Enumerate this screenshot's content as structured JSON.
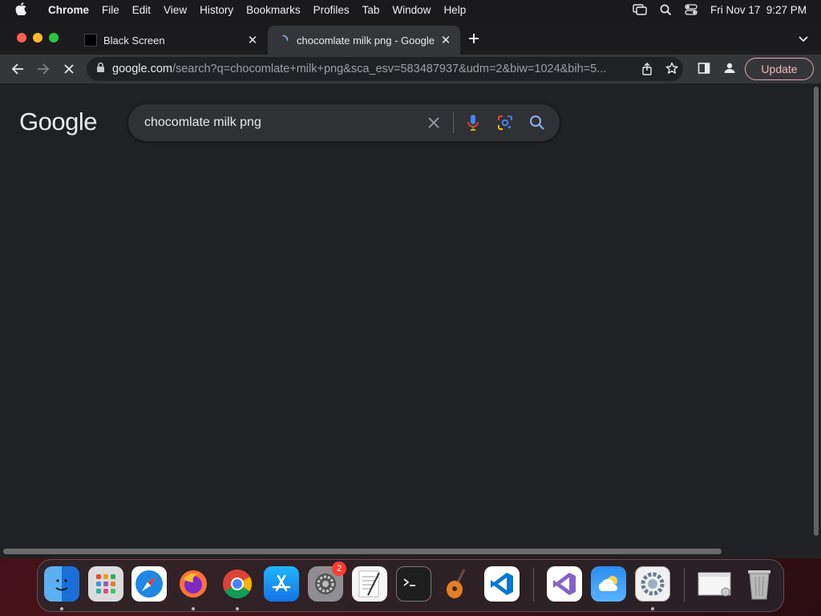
{
  "menubar": {
    "app_name": "Chrome",
    "items": [
      "File",
      "Edit",
      "View",
      "History",
      "Bookmarks",
      "Profiles",
      "Tab",
      "Window",
      "Help"
    ],
    "datetime": "Fri Nov 17  9:27 PM"
  },
  "tabs": [
    {
      "title": "Black Screen",
      "active": false
    },
    {
      "title": "chocomlate milk png - Google",
      "active": true
    }
  ],
  "toolbar": {
    "url_host": "google.com",
    "url_rest": "/search?q=chocomlate+milk+png&sca_esv=583487937&udm=2&biw=1024&bih=5...",
    "update_label": "Update"
  },
  "google": {
    "logo_text": "Google",
    "search_value": "chocomlate milk png"
  },
  "dock": {
    "apps": [
      "Finder",
      "Launchpad",
      "Safari",
      "Firefox",
      "Chrome",
      "App Store",
      "System Settings",
      "TextEdit",
      "Terminal",
      "GarageBand",
      "VS Code",
      "Visual Studio",
      "Weather",
      "Settings",
      "Preview",
      "Trash"
    ],
    "system_settings_badge": "2"
  },
  "colors": {
    "page_bg": "#202124",
    "toolbar_bg": "#35363a",
    "update_accent": "#f2b8b5"
  }
}
